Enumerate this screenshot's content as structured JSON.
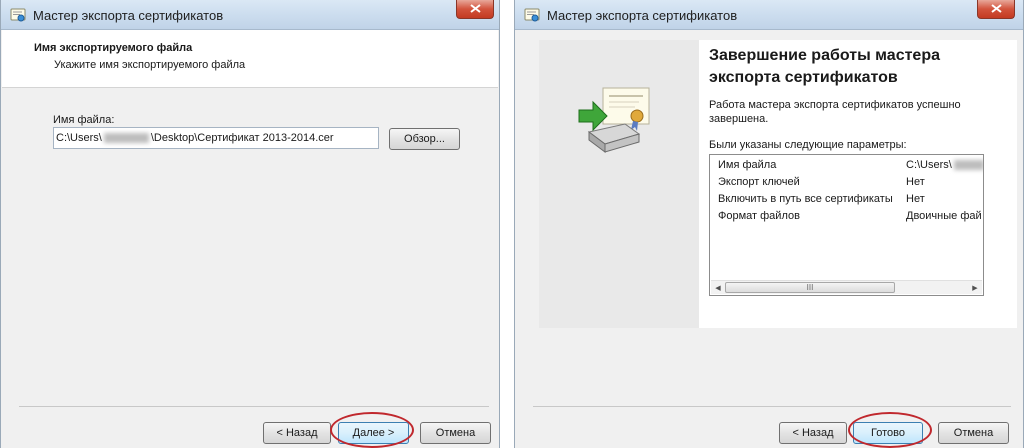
{
  "left_window": {
    "title": "Мастер экспорта сертификатов",
    "header_title": "Имя экспортируемого файла",
    "header_subtitle": "Укажите имя экспортируемого файла",
    "file_label": "Имя файла:",
    "file_value_prefix": "C:\\Users\\",
    "file_value_suffix": "\\Desktop\\Сертификат 2013-2014.cer",
    "browse_button": "Обзор...",
    "back_button": "< Назад",
    "next_button": "Далее >",
    "cancel_button": "Отмена"
  },
  "right_window": {
    "title": "Мастер экспорта сертификатов",
    "heading_line1": "Завершение работы мастера",
    "heading_line2": "экспорта сертификатов",
    "success_line1": "Работа мастера экспорта сертификатов успешно",
    "success_line2": "завершена.",
    "params_label": "Были указаны следующие параметры:",
    "params": [
      {
        "name": "Имя файла",
        "value": "C:\\Users\\"
      },
      {
        "name": "Экспорт ключей",
        "value": "Нет"
      },
      {
        "name": "Включить в путь все сертификаты",
        "value": "Нет"
      },
      {
        "name": "Формат файлов",
        "value": "Двоичные фай"
      }
    ],
    "scroll_thumb_grip": "III",
    "back_button": "< Назад",
    "finish_button": "Готово",
    "cancel_button": "Отмена"
  },
  "colors": {
    "highlight_ellipse": "#c0282d",
    "close_button": "#c9452d",
    "titlebar": "#cbdcee"
  },
  "icons": {
    "window": "certificate-window-icon",
    "close": "close-icon",
    "wizard": "certificate-export-icon"
  }
}
